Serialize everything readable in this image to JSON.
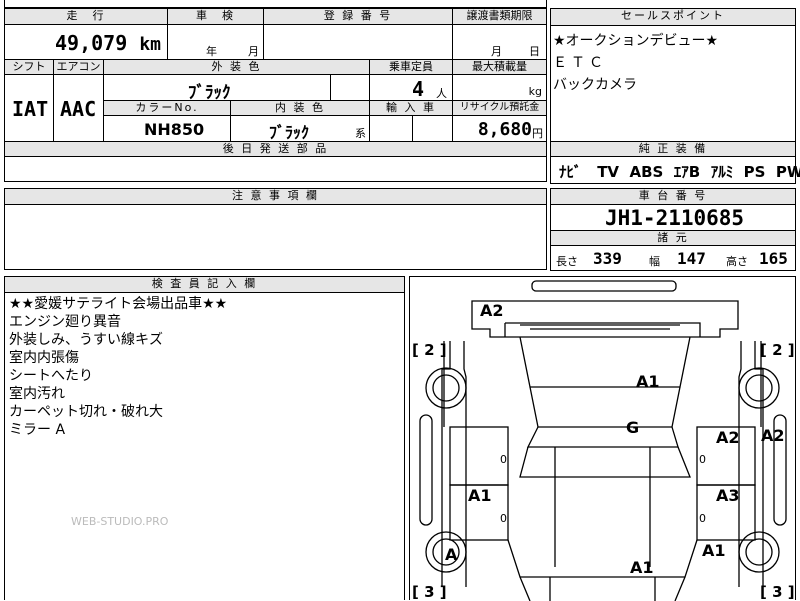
{
  "top_header": {
    "mileage_label": "走　行",
    "inspection_label": "車　検",
    "registration_label": "登 録 番 号",
    "transfer_deadline_label": "譲渡書類期限",
    "sales_points_label": "セールスポイント"
  },
  "mileage": {
    "value": "49,079",
    "unit": "km"
  },
  "inspection": {
    "year_label": "年",
    "month_label": "月"
  },
  "transfer_deadline": {
    "month_label": "月",
    "day_label": "日"
  },
  "sales_points": [
    "★オークションデビュー★",
    "ＥＴＣ",
    "バックカメラ"
  ],
  "spec_header": {
    "shift_label": "シフト",
    "aircon_label": "エアコン",
    "exterior_color_label": "外 装 色",
    "capacity_label": "乗車定員",
    "max_load_label": "最大積載量",
    "color_no_label": "カラーNo.",
    "interior_color_label": "内 装 色",
    "import_label": "輸 入 車",
    "recycle_label": "リサイクル預託金"
  },
  "specs": {
    "shift": "IAT",
    "aircon": "AAC",
    "exterior_color": "ﾌﾞﾗｯｸ",
    "capacity": "4",
    "capacity_unit": "人",
    "max_load_unit": "kg",
    "color_no": "NH850",
    "interior_color": "ﾌﾞﾗｯｸ",
    "interior_suffix": "系",
    "recycle_fee": "8,680",
    "recycle_unit": "円"
  },
  "later_parts_label": "後 日 発 送 部 品",
  "standard_equipment": {
    "label": "純 正 装 備",
    "items": [
      "ﾅﾋﾞ",
      "TV",
      "ABS",
      "ｴｱB",
      "ｱﾙﾐ",
      "PS",
      "PW"
    ]
  },
  "notes_label": "注 意 事 項 欄",
  "chassis": {
    "label": "車 台 番 号",
    "number": "JH1-2110685"
  },
  "dimensions": {
    "label": "諸 元",
    "length_label": "長さ",
    "length": "339",
    "width_label": "幅",
    "width": "147",
    "height_label": "高さ",
    "height": "165"
  },
  "inspector": {
    "label": "検 査 員 記 入 欄",
    "lines": [
      "★★愛媛サテライト会場出品車★★",
      "エンジン廻り異音",
      "外装しみ、うすい線キズ",
      "室内内張傷",
      "シートへたり",
      "室内汚れ",
      "カーペット切れ・破れ大",
      "ミラー A"
    ],
    "watermark": "WEB-STUDIO.PRO"
  },
  "car_map": {
    "marks": [
      "A2",
      "A1",
      "G",
      "A2",
      "A2",
      "A1",
      "A3",
      "A",
      "A1",
      "A1"
    ],
    "brackets": [
      "[ 2 ]",
      "[ 2 ]",
      "[ 3 ]",
      "[ 3 ]"
    ],
    "small_zero": [
      "0",
      "0",
      "0",
      "0"
    ]
  }
}
